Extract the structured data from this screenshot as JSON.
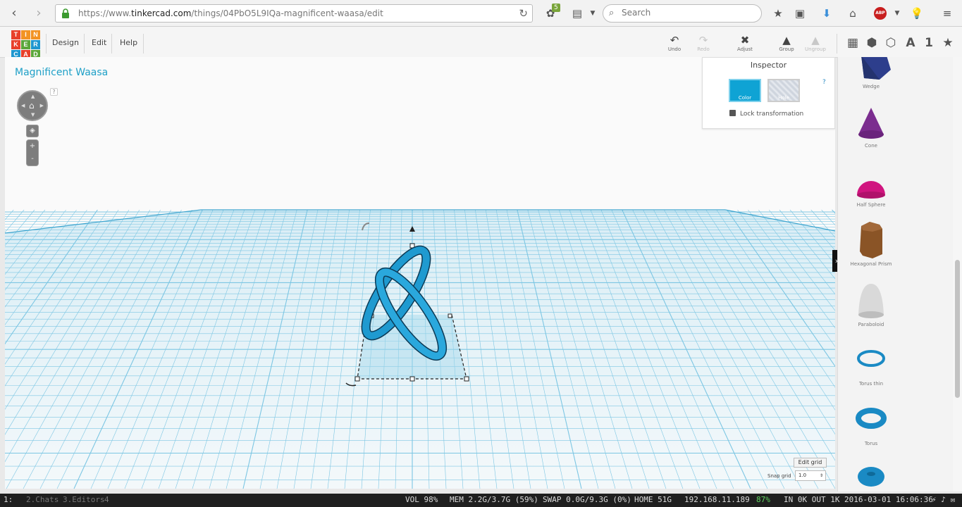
{
  "browser": {
    "url_prefix": "https://www.",
    "url_domain": "tinkercad.com",
    "url_path": "/things/04PbO5L9IQa-magnificent-waasa/edit",
    "extension_badge": "5",
    "search_placeholder": "Search"
  },
  "app": {
    "logo_letters": [
      "T",
      "I",
      "N",
      "K",
      "E",
      "R",
      "C",
      "A",
      "D"
    ],
    "logo_colors": [
      "#e8402a",
      "#f39323",
      "#f39323",
      "#e8402a",
      "#5ba63a",
      "#1f97cf",
      "#1f97cf",
      "#e8402a",
      "#5ba63a"
    ],
    "menu": [
      "Design",
      "Edit",
      "Help"
    ],
    "tools": {
      "undo": "Undo",
      "redo": "Redo",
      "adjust": "Adjust",
      "group": "Group",
      "ungroup": "Ungroup"
    },
    "view_icons": {
      "text": "A",
      "number": "1"
    }
  },
  "workplane": {
    "design_title": "Magnificent Waasa",
    "help": "?",
    "zoom_in": "+",
    "zoom_out": "-",
    "edit_grid": "Edit grid",
    "snap_grid_label": "Snap grid",
    "snap_grid_value": "1.0"
  },
  "inspector": {
    "title": "Inspector",
    "color_label": "Color",
    "hole_label": "Hole",
    "lock_label": "Lock transformation",
    "help": "?"
  },
  "shapes": [
    {
      "name": "Wedge",
      "color": "#2d3e8c"
    },
    {
      "name": "Cone",
      "color": "#7b2d8f"
    },
    {
      "name": "Half Sphere",
      "color": "#d0157f"
    },
    {
      "name": "Hexagonal Prism",
      "color": "#8a5426"
    },
    {
      "name": "Paraboloid",
      "color": "#d9d9d9"
    },
    {
      "name": "Torus thin",
      "color": "#1a8ac4"
    },
    {
      "name": "Torus",
      "color": "#1a8ac4"
    },
    {
      "name": "",
      "color": "#1a8ac4"
    }
  ],
  "statusbar": {
    "workspaces": "1:",
    "ws2": "2.Chats",
    "ws3": "3.Editors",
    "ws4": "4",
    "vol": "VOL 98%",
    "mem": "MEM 2.2G/3.7G (59%)",
    "swap": "SWAP 0.0G/9.3G (0%)",
    "home": "HOME 51G",
    "ip": "192.168.11.189",
    "battery": "87%",
    "net": "IN 0K OUT 1K",
    "datetime": "2016-03-01 16:06:36"
  }
}
